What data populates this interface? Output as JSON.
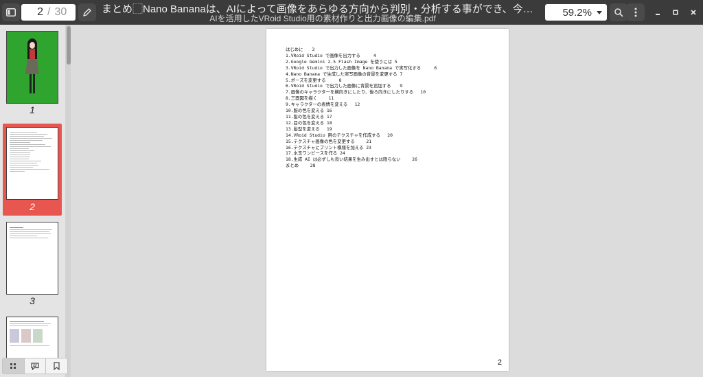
{
  "window": {
    "title_main": "まとめ⬚Nano Bananaは、AIによって画像をあらゆる方向から判別・分析する事ができ、今までの画像編集...",
    "title_sub": "AIを活用したVRoid Studio用の素材作りと出力画像の編集.pdf"
  },
  "toolbar": {
    "current_page": "2",
    "page_separator": "/",
    "total_pages": "30",
    "zoom": "59.2%"
  },
  "icons": {
    "sidebar_toggle": "sidebar-toggle-icon",
    "edit": "pencil-icon",
    "zoom_dropdown": "caret-down-icon",
    "search": "search-icon",
    "more": "kebab-menu-icon",
    "minimize": "minimize-icon",
    "maximize": "maximize-icon",
    "close": "close-icon",
    "thumbnails": "grid-icon",
    "annotations": "comment-icon",
    "bookmarks": "bookmark-icon"
  },
  "sidebar": {
    "thumbnails": [
      {
        "label": "1"
      },
      {
        "label": "2"
      },
      {
        "label": "3"
      }
    ]
  },
  "document": {
    "toc": [
      "はじめに　　3",
      "1.VRoid Studio で画像を出力する　　　4",
      "2.Google Gemini 2.5 Flash Image を使うには 5",
      "3.VRoid Studio で出力した画像を Nano Banana で実写化する　　　6",
      "4.Nano Banana で生成した実写画像の背景を変更する 7",
      "5.ポーズを変更する　　　8",
      "6.VRoid Studio で出力した画像に背景を追加する　　9",
      "7.画像のキャラクターを横向きにしたり、後ろ向きにしたりする　 10",
      "8.三面図を描く　　 11",
      "9.キャラクターの表情を変える　 12",
      "10.服の色を変える 16",
      "11.髪の色を変える 17",
      "12.目の色を変える 18",
      "13.髪型を変える　 19",
      "14.VRoid Studio 用のテクスチャを作成する　 20",
      "15.テクスチャ画像の色を変更する　　 21",
      "16.テクスチャにプリント模様を加える 23",
      "17.水玉ワンピースを作る 24",
      "18.生成 AI は必ずしも良い結果を生み出すとは限らない　　 26",
      "まとめ　　 28"
    ],
    "page_number": "2"
  },
  "colors": {
    "titlebar": "#3b3b3b",
    "active_thumb": "#e8574f",
    "cover_green": "#2fa52f"
  }
}
